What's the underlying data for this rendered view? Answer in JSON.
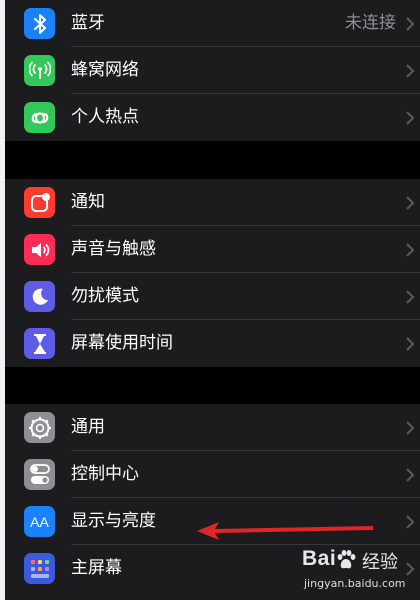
{
  "colors": {
    "background": "#000000",
    "group_background": "#1c1c1e",
    "separator": "#38383a",
    "secondary_text": "#8e8e93",
    "annotation_arrow": "#e0242a"
  },
  "groups": [
    {
      "items": [
        {
          "label": "蓝牙",
          "value": "未连接",
          "icon": "bluetooth-icon",
          "icon_color": "#1a82fb"
        },
        {
          "label": "蜂窝网络",
          "value": "",
          "icon": "cellular-antenna-icon",
          "icon_color": "#34c759"
        },
        {
          "label": "个人热点",
          "value": "",
          "icon": "personal-hotspot-icon",
          "icon_color": "#34c759"
        }
      ]
    },
    {
      "items": [
        {
          "label": "通知",
          "value": "",
          "icon": "notifications-icon",
          "icon_color": "#ff3b30"
        },
        {
          "label": "声音与触感",
          "value": "",
          "icon": "speaker-icon",
          "icon_color": "#ff2d55"
        },
        {
          "label": "勿扰模式",
          "value": "",
          "icon": "moon-icon",
          "icon_color": "#5e5ce6"
        },
        {
          "label": "屏幕使用时间",
          "value": "",
          "icon": "hourglass-icon",
          "icon_color": "#5e5ce6"
        }
      ]
    },
    {
      "items": [
        {
          "label": "通用",
          "value": "",
          "icon": "gear-icon",
          "icon_color": "#8e8e93"
        },
        {
          "label": "控制中心",
          "value": "",
          "icon": "toggle-switches-icon",
          "icon_color": "#8e8e93"
        },
        {
          "label": "显示与亮度",
          "value": "",
          "icon": "text-size-aa-icon",
          "icon_color": "#1a82fb",
          "icon_text": "AA"
        },
        {
          "label": "主屏幕",
          "value": "",
          "icon": "home-screen-grid-icon",
          "icon_color": "#3a5bde"
        }
      ]
    }
  ],
  "watermark": {
    "brand_left": "Bai",
    "brand_right": "经验",
    "url": "jingyan.baidu.com"
  }
}
